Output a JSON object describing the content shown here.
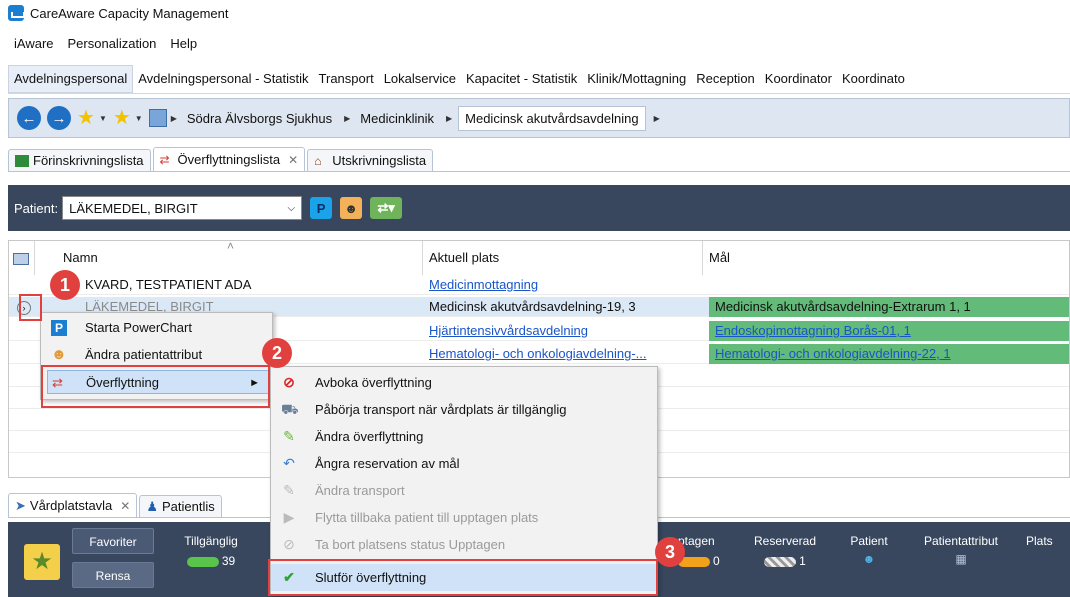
{
  "app": {
    "title": "CareAware Capacity Management"
  },
  "menubar": [
    "iAware",
    "Personalization",
    "Help"
  ],
  "perspectives": [
    "Avdelningspersonal",
    "Avdelningspersonal - Statistik",
    "Transport",
    "Lokalservice",
    "Kapacitet - Statistik",
    "Klinik/Mottagning",
    "Reception",
    "Koordinator",
    "Koordinato"
  ],
  "breadcrumbs": [
    "Södra Älvsborgs Sjukhus",
    "Medicinklinik",
    "Medicinsk akutvårdsavdelning"
  ],
  "tabs": [
    "Förinskrivningslista",
    "Överflyttningslista",
    "Utskrivningslista"
  ],
  "patient": {
    "label": "Patient:",
    "selected": "LÄKEMEDEL, BIRGIT",
    "pc_letter": "P"
  },
  "table": {
    "headers": [
      "Namn",
      "Aktuell plats",
      "Mål"
    ],
    "rows": [
      {
        "name": "KVARD, TESTPATIENT ADA",
        "current": "Medicinmottagning",
        "target": ""
      },
      {
        "name": "LÄKEMEDEL, BIRGIT",
        "current": "Medicinsk akutvårdsavdelning-19, 3",
        "target": "Medicinsk akutvårdsavdelning-Extrarum 1, 1"
      },
      {
        "name": "",
        "current": "Hjärtintensivvårdsavdelning",
        "target": "Endoskopimottagning Borås-01, 1"
      },
      {
        "name": "",
        "current": "Hematologi- och onkologiavdelning-...",
        "target": "Hematologi- och onkologiavdelning-22, 1"
      }
    ]
  },
  "context_menu": [
    "Starta PowerChart",
    "Ändra patientattribut",
    "Överflyttning"
  ],
  "submenu": [
    {
      "label": "Avboka överflyttning",
      "icon": "cancel-icon",
      "enabled": true
    },
    {
      "label": "Påbörja transport när vårdplats är tillgänglig",
      "icon": "ambulance-icon",
      "enabled": true
    },
    {
      "label": "Ändra överflyttning",
      "icon": "pencil-icon",
      "enabled": true
    },
    {
      "label": "Ångra reservation av mål",
      "icon": "undo-icon",
      "enabled": true
    },
    {
      "label": "Ändra transport",
      "icon": "pencil-icon",
      "enabled": false
    },
    {
      "label": "Flytta tillbaka patient till upptagen plats",
      "icon": "arrow-icon",
      "enabled": false
    },
    {
      "label": "Ta bort platsens status Upptagen",
      "icon": "cancel-icon",
      "enabled": false
    },
    {
      "label": "Slutför överflyttning",
      "icon": "checkmark-icon",
      "enabled": true
    }
  ],
  "bottom_tabs": [
    "Vårdplatstavla",
    "Patientlis"
  ],
  "bottom_toolbar": {
    "favoriter": "Favoriter",
    "rensa": "Rensa",
    "tillganglig": "Tillgänglig",
    "tillganglig_count": "39",
    "upptagen": "ptagen",
    "upptagen_count": "0",
    "reserverad": "Reserverad",
    "reserverad_count": "1",
    "patient": "Patient",
    "patientattribut": "Patientattribut",
    "plats": "Plats"
  },
  "annotations": [
    "1",
    "2",
    "3"
  ],
  "colors": {
    "accent": "#1f6fc5",
    "dark_bar": "#38475e",
    "target_green": "#62bb78",
    "annotation_red": "#e0413f"
  }
}
